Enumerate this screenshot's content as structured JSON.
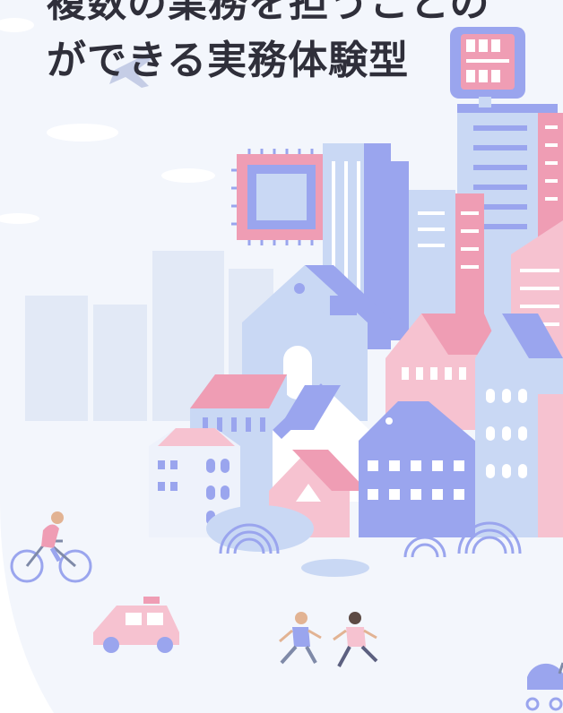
{
  "headline": {
    "line1": "複数の業務を担うことの",
    "line2": "ができる実務体験型"
  },
  "colors": {
    "background": "#f3f6fc",
    "text": "#2f2f3a",
    "blue": "#9aa5ee",
    "light_blue": "#c9d8f4",
    "pink": "#ef9db4",
    "light_pink": "#f6c2d0"
  }
}
